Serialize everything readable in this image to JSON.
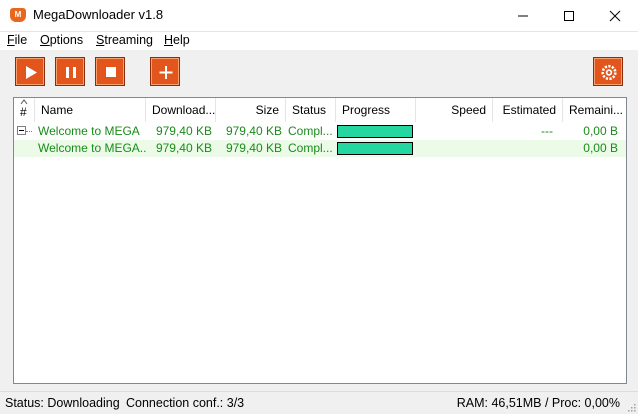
{
  "window": {
    "title": "MegaDownloader v1.8",
    "icon": "mega-app-icon",
    "icon_letter": "M"
  },
  "menu": [
    {
      "accel": "F",
      "rest": "ile"
    },
    {
      "accel": "O",
      "rest": "ptions"
    },
    {
      "accel": "S",
      "rest": "treaming"
    },
    {
      "accel": "H",
      "rest": "elp"
    }
  ],
  "toolbar": {
    "buttons": [
      "play-icon",
      "pause-icon",
      "stop-icon",
      "add-icon"
    ],
    "settings": "gear-icon",
    "accent": "#e2561d"
  },
  "table": {
    "headers": {
      "num": "#",
      "name": "Name",
      "downloaded": "Download...",
      "size": "Size",
      "status": "Status",
      "progress": "Progress",
      "speed": "Speed",
      "estimated": "Estimated",
      "remaining": "Remaini..."
    },
    "rows": [
      {
        "name": "Welcome to MEGA",
        "downloaded": "979,40 KB",
        "size": "979,40 KB",
        "status": "Compl...",
        "progress": 1.0,
        "speed": "",
        "estimated": "---",
        "remaining": "0,00 B"
      },
      {
        "name": "Welcome to MEGA....",
        "downloaded": "979,40 KB",
        "size": "979,40 KB",
        "status": "Compl...",
        "progress": 1.0,
        "speed": "",
        "estimated": "",
        "remaining": "0,00 B"
      }
    ],
    "text_color": "#1a8c1a",
    "progress_color": "#24d6a0"
  },
  "status": {
    "state": "Status: Downloading",
    "connection": "Connection conf.: 3/3",
    "resources": "RAM: 46,51MB / Proc: 0,00%"
  }
}
